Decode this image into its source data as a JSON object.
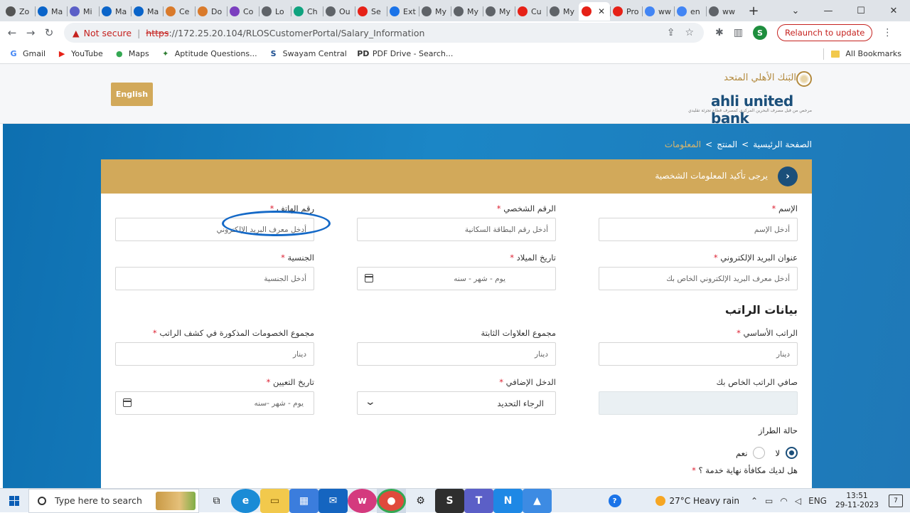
{
  "browser": {
    "tabs": [
      {
        "label": "Zo",
        "color": "#555"
      },
      {
        "label": "Ma",
        "color": "#0a64c9"
      },
      {
        "label": "Mi",
        "color": "#5b5fc7"
      },
      {
        "label": "Ma",
        "color": "#0a64c9"
      },
      {
        "label": "Ma",
        "color": "#0a64c9"
      },
      {
        "label": "Ce",
        "color": "#d97a2b"
      },
      {
        "label": "Do",
        "color": "#d97a2b"
      },
      {
        "label": "Co",
        "color": "#7b3fbf"
      },
      {
        "label": "Lo",
        "color": "#5f6368"
      },
      {
        "label": "Ch",
        "color": "#10a37f"
      },
      {
        "label": "Ou",
        "color": "#5f6368"
      },
      {
        "label": "Se",
        "color": "#e62117"
      },
      {
        "label": "Ext",
        "color": "#1a73e8"
      },
      {
        "label": "My",
        "color": "#5f6368"
      },
      {
        "label": "My",
        "color": "#5f6368"
      },
      {
        "label": "My",
        "color": "#5f6368"
      },
      {
        "label": "Cu",
        "color": "#e62117"
      },
      {
        "label": "My",
        "color": "#5f6368"
      }
    ],
    "active_tab": {
      "label": "",
      "color": "#e62117"
    },
    "after_tabs": [
      {
        "label": "Pro",
        "color": "#e62117"
      },
      {
        "label": "ww",
        "color": "#4285f4"
      },
      {
        "label": "en",
        "color": "#4285f4"
      },
      {
        "label": "ww",
        "color": "#5f6368"
      }
    ],
    "not_secure": "Not secure",
    "url_scheme": "https",
    "url_rest": "://172.25.20.104/RLOSCustomerPortal/Salary_Information",
    "profile_initial": "S",
    "relaunch": "Relaunch to update",
    "bookmarks": [
      {
        "label": "Gmail",
        "icon": "G",
        "color": "#4285f4"
      },
      {
        "label": "YouTube",
        "icon": "▶",
        "color": "#e62117"
      },
      {
        "label": "Maps",
        "icon": "●",
        "color": "#34a853"
      },
      {
        "label": "Aptitude Questions...",
        "icon": "✦",
        "color": "#2e7d32"
      },
      {
        "label": "Swayam Central",
        "icon": "S",
        "color": "#1a4d8f"
      },
      {
        "label": "PDF Drive - Search...",
        "icon": "PD",
        "color": "#333"
      }
    ],
    "all_bookmarks": "All Bookmarks"
  },
  "site": {
    "lang_button": "English",
    "logo_ar": "البَنك الأهلي المتحد",
    "logo_en": "ahli united bank",
    "logo_tag": "مرخص من قبل مصرف البحرين المركزي كمصرف قطاع تجزئة تقليدي",
    "breadcrumb": {
      "home": "الصفحة الرئيسية",
      "sep1": ">",
      "product": "المنتج",
      "sep2": ">",
      "current": "المعلومات"
    },
    "banner": "يرجى تأكيد المعلومات الشخصية",
    "banner_icon": "chevron-right-icon",
    "personal": {
      "name": {
        "label": "الإسم",
        "placeholder": "أدخل الإسم"
      },
      "civil_id": {
        "label": "الرقم الشخصي",
        "placeholder": "أدخل رقم البطاقة السكانية"
      },
      "phone": {
        "label": "رقم الهاتف",
        "placeholder": "أدخل معرف البريد الإلكتروني"
      },
      "email": {
        "label": "عنوان البريد الإلكتروني",
        "placeholder": "أدخل معرف البريد الإلكتروني الخاص بك"
      },
      "dob": {
        "label": "تاريخ الميلاد",
        "placeholder": "يوم - شهر - سنه"
      },
      "nationality": {
        "label": "الجنسية",
        "placeholder": "أدخل الجنسية"
      }
    },
    "salary_section": "بيانات الراتب",
    "salary": {
      "basic": {
        "label": "الراتب الأساسي",
        "placeholder": "دينار"
      },
      "allowances": {
        "label": "مجموع العلاوات الثابتة",
        "placeholder": "دينار"
      },
      "deductions": {
        "label": "مجموع الخصومات المذكورة في كشف الراتب",
        "placeholder": "دينار"
      },
      "net": {
        "label": "صافي الراتب الخاص بك",
        "value": ""
      },
      "extra_income": {
        "label": "الدخل الإضافي",
        "value": "الرجاء التحديد"
      },
      "join_date": {
        "label": "تاريخ التعيين",
        "placeholder": "يوم - شهر -سنه"
      }
    },
    "model_status": "حالة الطراز",
    "radio_no": "لا",
    "radio_yes": "نعم",
    "eos_question": "هل لديك مكافأة نهاية خدمة ؟",
    "req": "*"
  },
  "taskbar": {
    "search_placeholder": "Type here to search",
    "weather": "27°C  Heavy rain",
    "lang": "ENG",
    "time": "13:51",
    "date": "29-11-2023",
    "notifications": "7"
  }
}
